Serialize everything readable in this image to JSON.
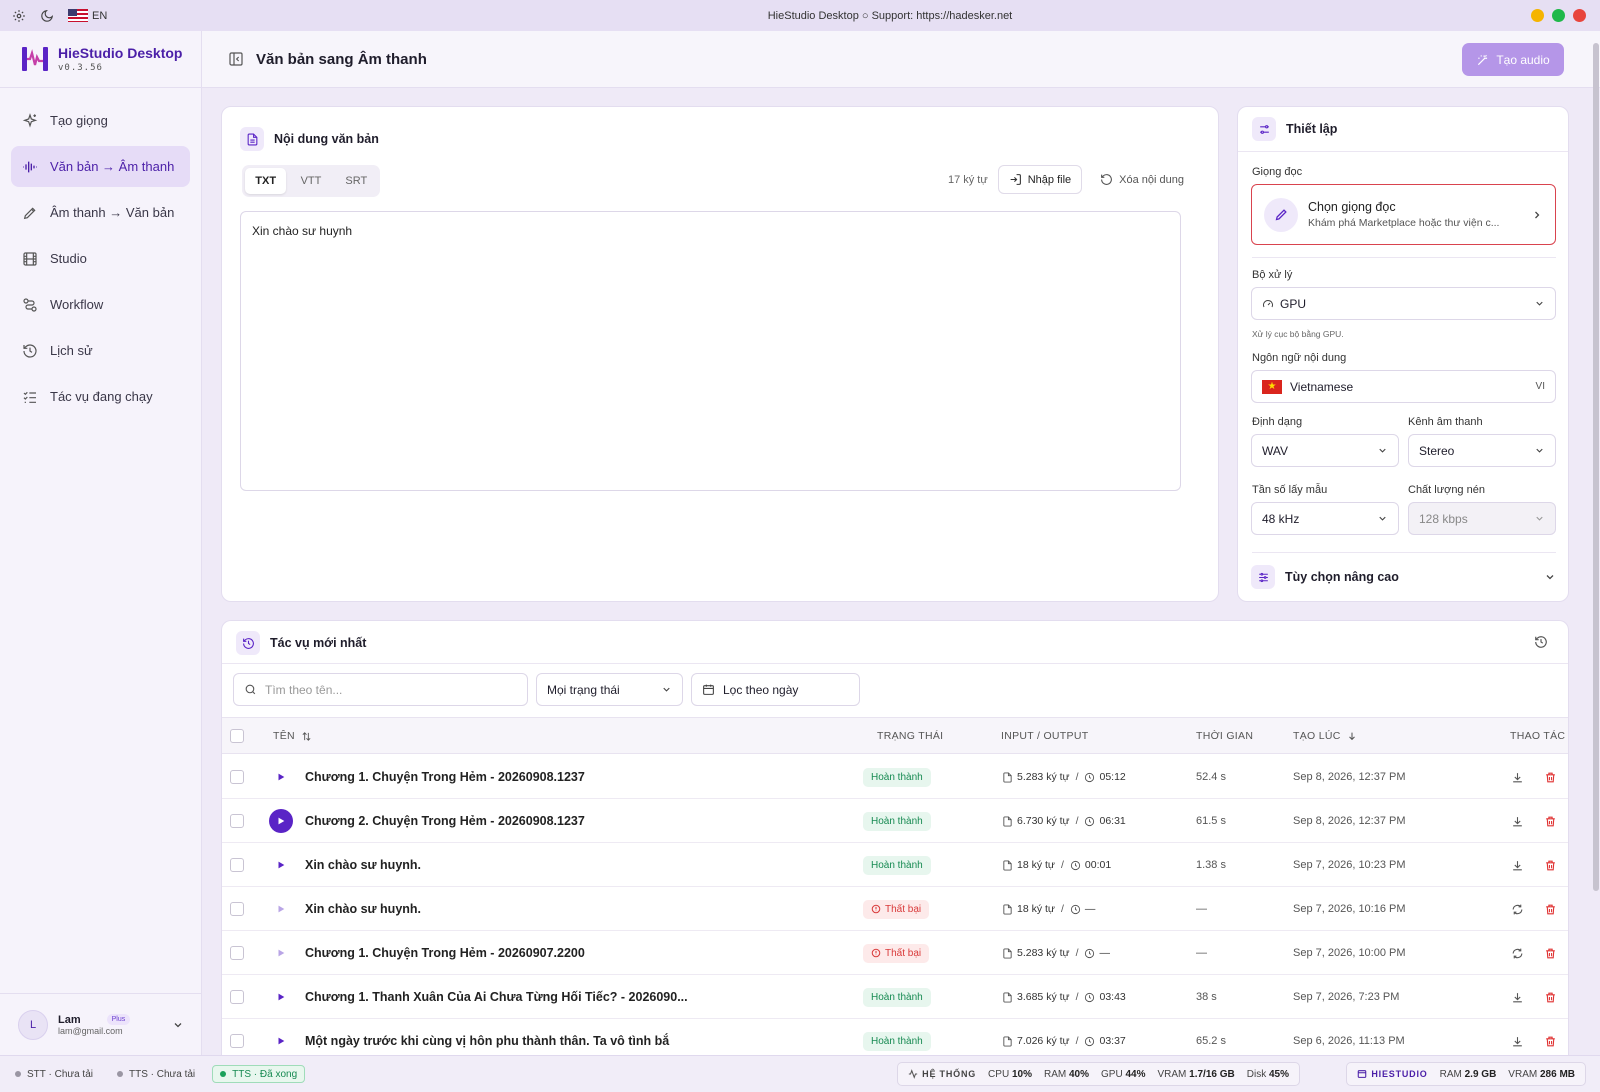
{
  "titlebar": {
    "title": "HieStudio Desktop ○ Support: https://hadesker.net",
    "lang": "EN",
    "lights": [
      "#f5b400",
      "#1fb84a",
      "#e8453c"
    ]
  },
  "brand": {
    "name": "HieStudio Desktop",
    "version": "v0.3.56",
    "accent": "#4b1fa8"
  },
  "nav": [
    {
      "label": "Tạo giọng",
      "icon": "sparkles-icon"
    },
    {
      "label": "Văn bản → Âm thanh",
      "icon": "waveform-icon",
      "active": true
    },
    {
      "label": "Âm thanh → Văn bản",
      "icon": "pen-icon"
    },
    {
      "label": "Studio",
      "icon": "film-icon"
    },
    {
      "label": "Workflow",
      "icon": "workflow-icon"
    },
    {
      "label": "Lịch sử",
      "icon": "history-icon"
    },
    {
      "label": "Tác vụ đang chạy",
      "icon": "tasks-icon"
    }
  ],
  "user": {
    "initial": "L",
    "name": "Lam",
    "email": "lam@gmail.com",
    "plan": "Plus"
  },
  "header": {
    "title": "Văn bản sang Âm thanh",
    "create_label": "Tạo audio"
  },
  "editor": {
    "title": "Nội dung văn bản",
    "tabs": [
      "TXT",
      "VTT",
      "SRT"
    ],
    "char_count": "17 ký tự",
    "import_label": "Nhập file",
    "clear_label": "Xóa nội dung",
    "text": "Xin chào sư huynh"
  },
  "settings": {
    "title": "Thiết lập",
    "voice_label": "Giọng đọc",
    "voice_title": "Chọn giọng đọc",
    "voice_desc": "Khám phá Marketplace hoặc thư viện c...",
    "processor_label": "Bộ xử lý",
    "processor_value": "GPU",
    "processor_hint": "Xử lý cục bộ bằng GPU.",
    "language_label": "Ngôn ngữ nội dung",
    "language_value": "Vietnamese",
    "language_code": "VI",
    "format_label": "Định dạng",
    "format_value": "WAV",
    "channel_label": "Kênh âm thanh",
    "channel_value": "Stereo",
    "rate_label": "Tần số lấy mẫu",
    "rate_value": "48 kHz",
    "quality_label": "Chất lượng nén",
    "quality_value": "128 kbps",
    "advanced_label": "Tùy chọn nâng cao"
  },
  "tasks": {
    "title": "Tác vụ mới nhất",
    "search_placeholder": "Tìm theo tên...",
    "status_filter": "Mọi trạng thái",
    "date_filter": "Lọc theo ngày",
    "columns": {
      "name": "TÊN",
      "status": "TRẠNG THÁI",
      "io": "INPUT / OUTPUT",
      "time": "THỜI GIAN",
      "created": "TẠO LÚC",
      "actions": "THAO TÁC"
    },
    "rows": [
      {
        "name": "Chương 1. Chuyện Trong Hẻm - 20260908.1237",
        "status": "Hoàn thành",
        "ok": true,
        "chars": "5.283 ký tự",
        "dur": "05:12",
        "time": "52.4 s",
        "created": "Sep 8, 2026, 12:37 PM"
      },
      {
        "name": "Chương 2. Chuyện Trong Hẻm - 20260908.1237",
        "status": "Hoàn thành",
        "ok": true,
        "chars": "6.730 ký tự",
        "dur": "06:31",
        "time": "61.5 s",
        "created": "Sep 8, 2026, 12:37 PM",
        "playing": true
      },
      {
        "name": "Xin chào sư huynh.",
        "status": "Hoàn thành",
        "ok": true,
        "chars": "18 ký tự",
        "dur": "00:01",
        "time": "1.38 s",
        "created": "Sep 7, 2026, 10:23 PM"
      },
      {
        "name": "Xin chào sư huynh.",
        "status": "Thất bại",
        "ok": false,
        "chars": "18 ký tự",
        "dur": "—",
        "time": "—",
        "created": "Sep 7, 2026, 10:16 PM"
      },
      {
        "name": "Chương 1. Chuyện Trong Hẻm - 20260907.2200",
        "status": "Thất bại",
        "ok": false,
        "chars": "5.283 ký tự",
        "dur": "—",
        "time": "—",
        "created": "Sep 7, 2026, 10:00 PM"
      },
      {
        "name": "Chương 1. Thanh Xuân Của Ai Chưa Từng Hối Tiếc? - 2026090...",
        "status": "Hoàn thành",
        "ok": true,
        "chars": "3.685 ký tự",
        "dur": "03:43",
        "time": "38 s",
        "created": "Sep 7, 2026, 7:23 PM"
      },
      {
        "name": "Một ngày trước khi cùng vị hôn phu thành thân. Ta vô tình bắ",
        "status": "Hoàn thành",
        "ok": true,
        "chars": "7.026 ký tự",
        "dur": "03:37",
        "time": "65.2 s",
        "created": "Sep 6, 2026, 11:13 PM"
      }
    ]
  },
  "statusbar": {
    "stt": "STT · Chưa tải",
    "tts_load": "TTS · Chưa tải",
    "tts_done": "TTS · Đã xong",
    "system_label": "HỆ THỐNG",
    "cpu_label": "CPU",
    "cpu": "10%",
    "ram_label": "RAM",
    "ram": "40%",
    "gpu_label": "GPU",
    "gpu": "44%",
    "vram_label": "VRAM",
    "vram": "1.7/16 GB",
    "disk_label": "Disk",
    "disk": "45%",
    "app_label": "HIESTUDIO",
    "app_ram": "2.9 GB",
    "app_vram": "286 MB"
  }
}
